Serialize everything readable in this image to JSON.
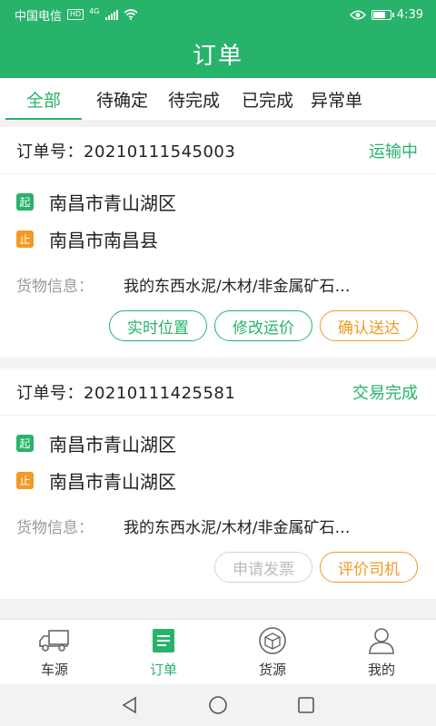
{
  "status_bar": {
    "carrier": "中国电信",
    "hd": "HD",
    "network": "4G",
    "time": "4:39",
    "battery_level": 0.75
  },
  "header": {
    "title": "订单"
  },
  "tabs": [
    {
      "label": "全部",
      "active": true
    },
    {
      "label": "待确定",
      "active": false
    },
    {
      "label": "待完成",
      "active": false
    },
    {
      "label": "已完成",
      "active": false
    },
    {
      "label": "异常单",
      "active": false
    }
  ],
  "orders": [
    {
      "order_label": "订单号：",
      "order_no": "20210111545003",
      "status": "运输中",
      "start_tag": "起",
      "start": "南昌市青山湖区",
      "end_tag": "止",
      "end": "南昌市南昌县",
      "goods_label": "货物信息：",
      "goods": "我的东西水泥/木材/非金属矿石…",
      "actions": [
        "实时位置",
        "修改运价",
        "确认送达"
      ]
    },
    {
      "order_label": "订单号：",
      "order_no": "20210111425581",
      "status": "交易完成",
      "start_tag": "起",
      "start": "南昌市青山湖区",
      "end_tag": "止",
      "end": "南昌市青山湖区",
      "goods_label": "货物信息：",
      "goods": "我的东西水泥/木材/非金属矿石…",
      "actions": [
        "申请发票",
        "评价司机"
      ]
    }
  ],
  "bottom_nav": [
    {
      "label": "车源",
      "icon": "truck-icon"
    },
    {
      "label": "订单",
      "icon": "order-list-icon"
    },
    {
      "label": "货源",
      "icon": "cargo-box-icon"
    },
    {
      "label": "我的",
      "icon": "user-icon"
    }
  ],
  "colors": {
    "primary": "#27b36a",
    "accent": "#f29a24"
  }
}
